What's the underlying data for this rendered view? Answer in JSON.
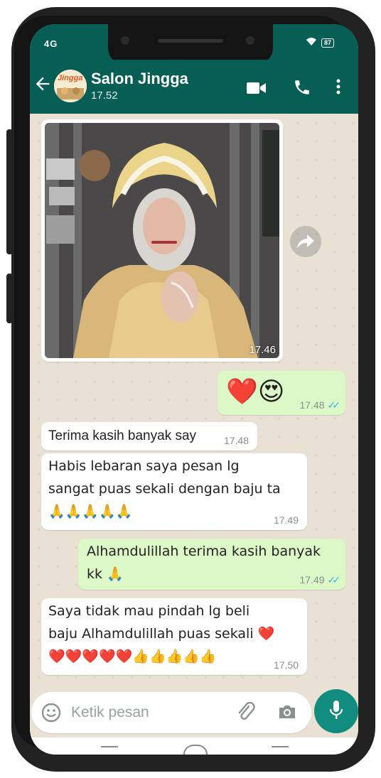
{
  "status_bar": {
    "network": "4G",
    "battery": "87"
  },
  "header": {
    "contact_name": "Salon Jingga",
    "subtitle": "17.52",
    "avatar_text": "Jingga"
  },
  "messages": [
    {
      "type": "image",
      "direction": "in",
      "time": "17.46"
    },
    {
      "direction": "out",
      "text": "❤️😍",
      "time": "17.48",
      "read": true
    },
    {
      "direction": "in",
      "text": "Terima kasih banyak say",
      "time": "17.48"
    },
    {
      "direction": "in",
      "text": "Habis lebaran saya pesan lg sangat puas sekali dengan baju ta🙏🙏🙏🙏🙏",
      "time": "17.49"
    },
    {
      "direction": "out",
      "text": "Alhamdulillah terima kasih banyak kk 🙏",
      "time": "17.49",
      "read": true
    },
    {
      "direction": "in",
      "text": "Saya tidak mau pindah lg beli baju Alhamdulillah puas sekali ❤️❤️❤️❤️❤️❤️👍👍👍👍👍",
      "time": "17.50"
    }
  ],
  "input": {
    "placeholder": "Ketik pesan"
  },
  "colors": {
    "header": "#075e54",
    "outgoing": "#dcf8c6",
    "incoming": "#ffffff",
    "mic": "#128c7e",
    "read_ticks": "#34b7f1"
  },
  "icons": [
    "back-arrow-icon",
    "video-call-icon",
    "phone-icon",
    "more-icon",
    "forward-icon",
    "emoji-icon",
    "attach-icon",
    "camera-icon",
    "mic-icon"
  ]
}
